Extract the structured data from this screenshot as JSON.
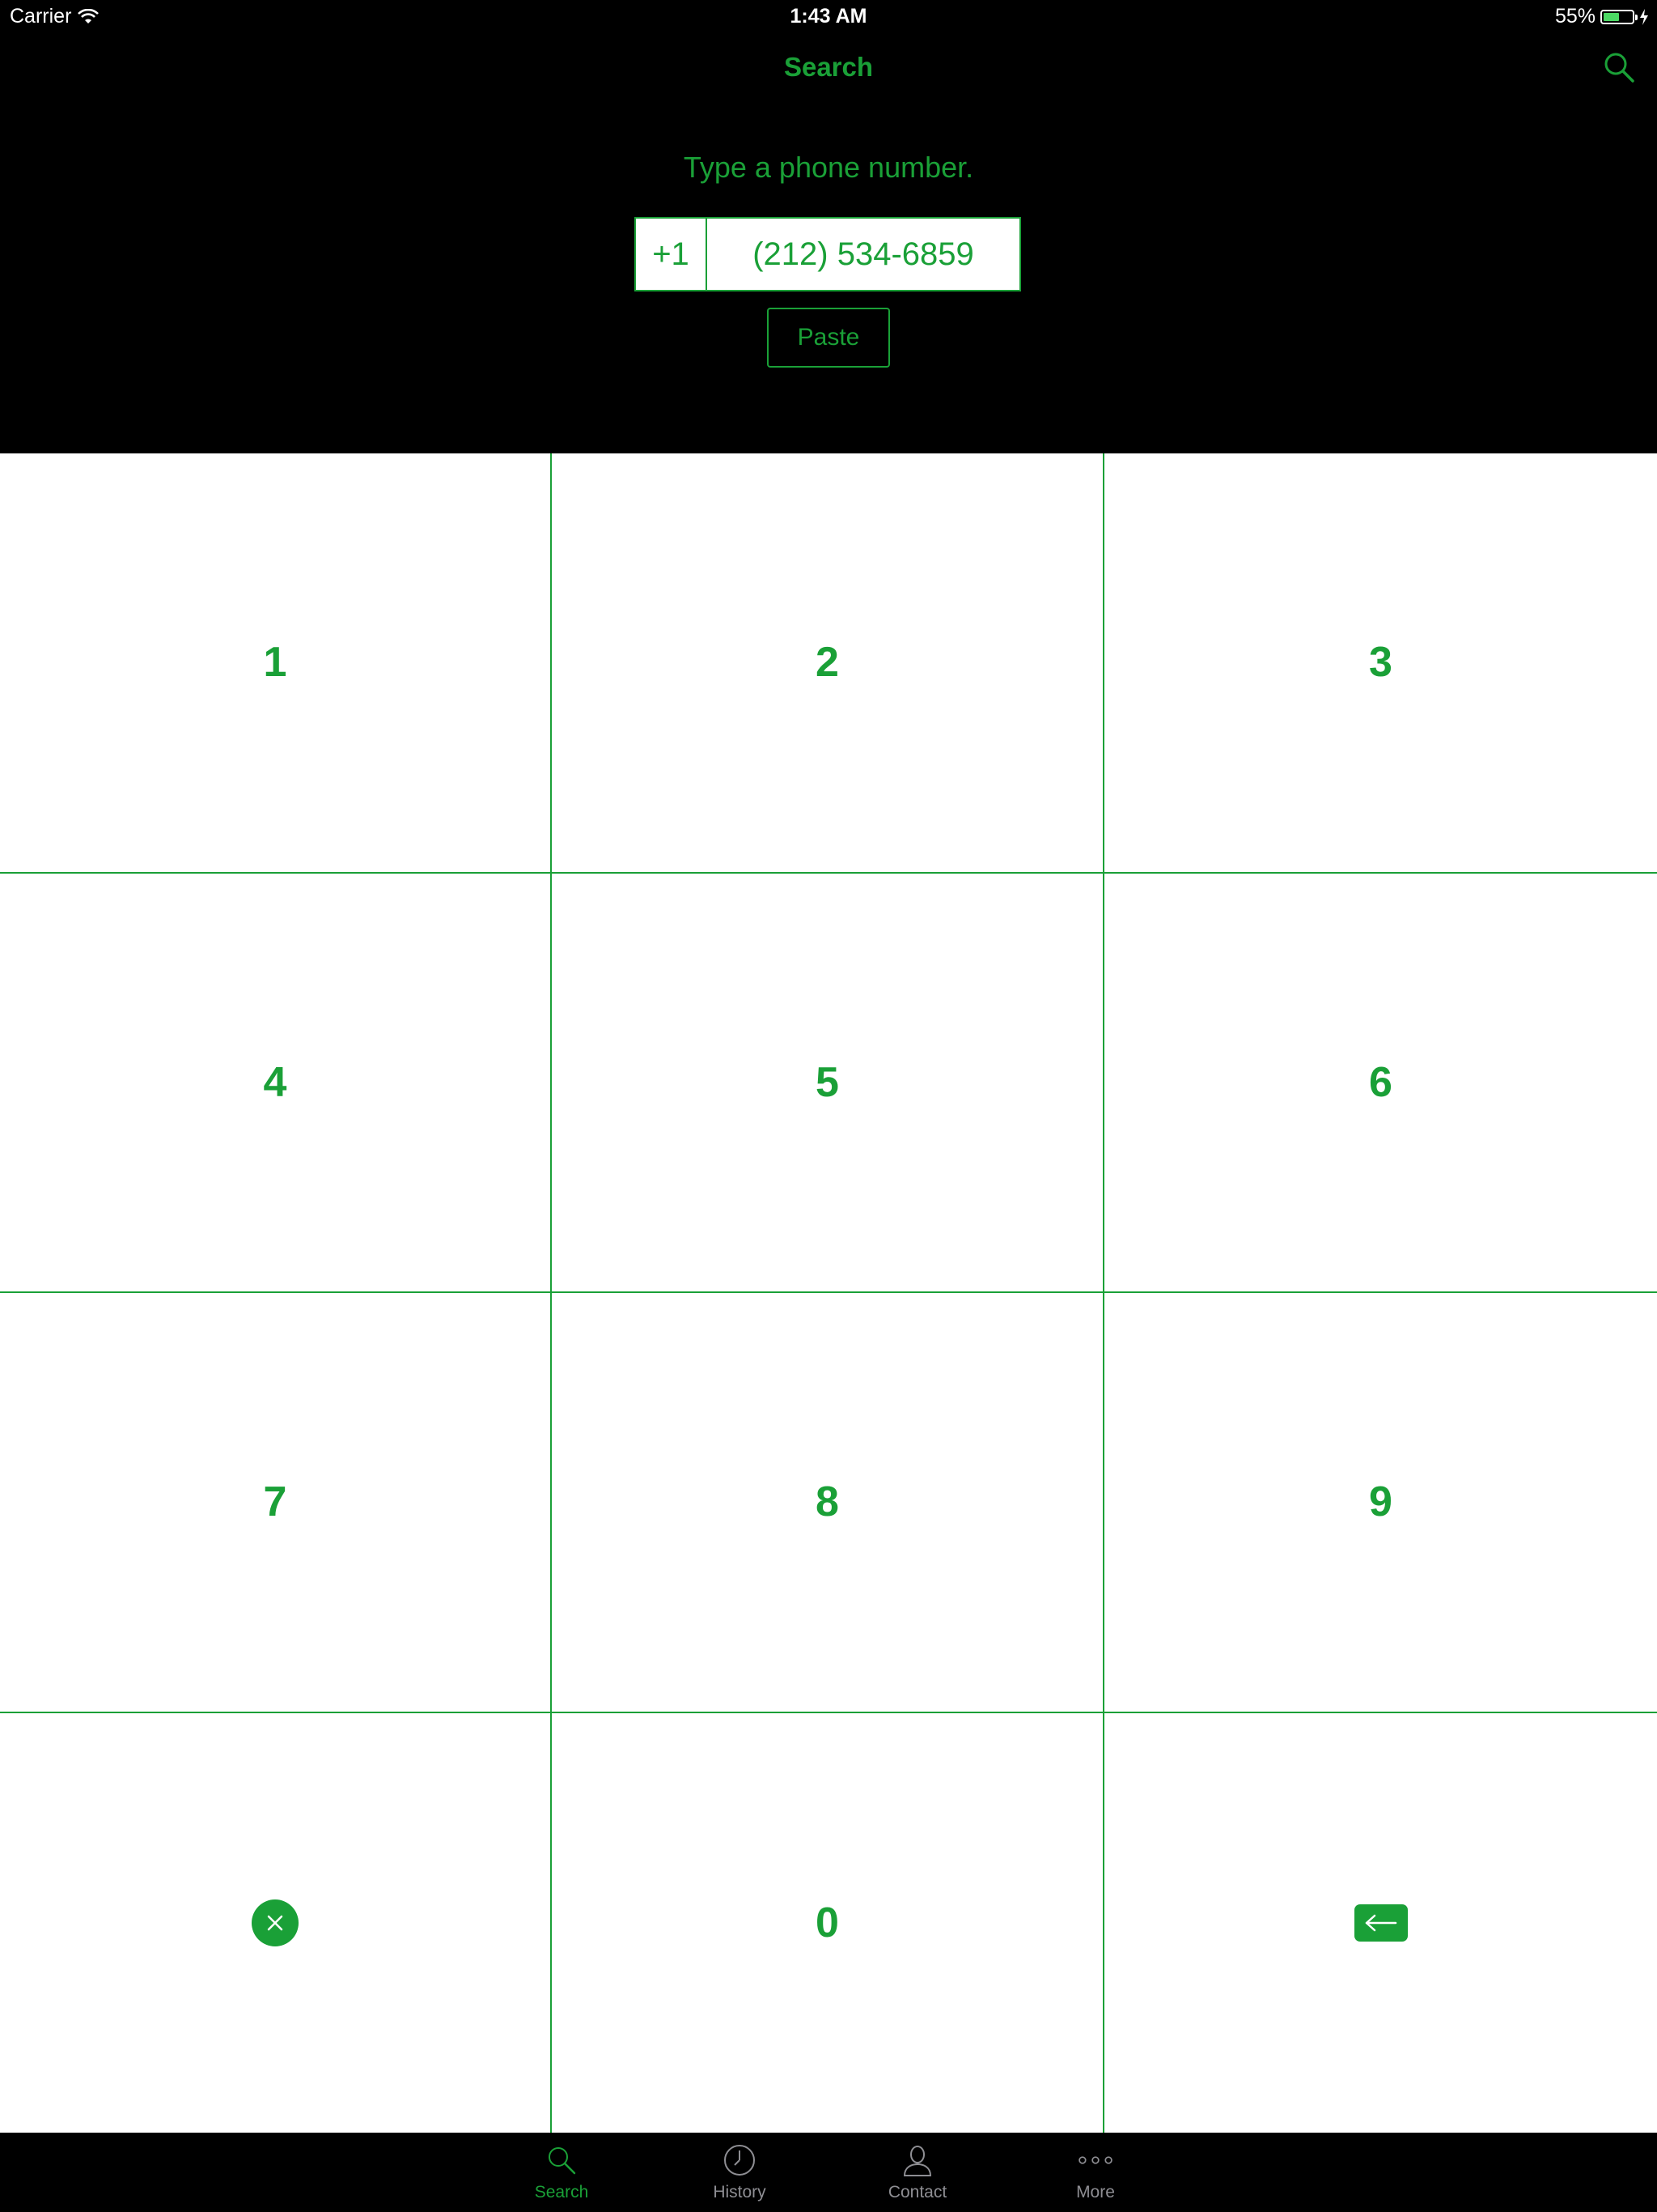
{
  "status_bar": {
    "carrier": "Carrier",
    "time": "1:43 AM",
    "battery_text": "55%",
    "battery_level": 0.55
  },
  "nav": {
    "title": "Search",
    "search_icon": "search-icon"
  },
  "header": {
    "instruction": "Type a phone number.",
    "country_code": "+1",
    "phone_number": "(212) 534-6859",
    "paste_label": "Paste"
  },
  "keypad": {
    "keys": [
      "1",
      "2",
      "3",
      "4",
      "5",
      "6",
      "7",
      "8",
      "9",
      "0"
    ],
    "clear_icon": "clear-icon",
    "backspace_icon": "backspace-icon"
  },
  "tabs": [
    {
      "label": "Search",
      "icon": "search-icon",
      "active": true
    },
    {
      "label": "History",
      "icon": "clock-icon",
      "active": false
    },
    {
      "label": "Contact",
      "icon": "person-icon",
      "active": false
    },
    {
      "label": "More",
      "icon": "more-icon",
      "active": false
    }
  ],
  "colors": {
    "accent": "#1aa037",
    "background": "#000000",
    "keypad_background": "#ffffff",
    "inactive_tab": "#8e8e93"
  }
}
